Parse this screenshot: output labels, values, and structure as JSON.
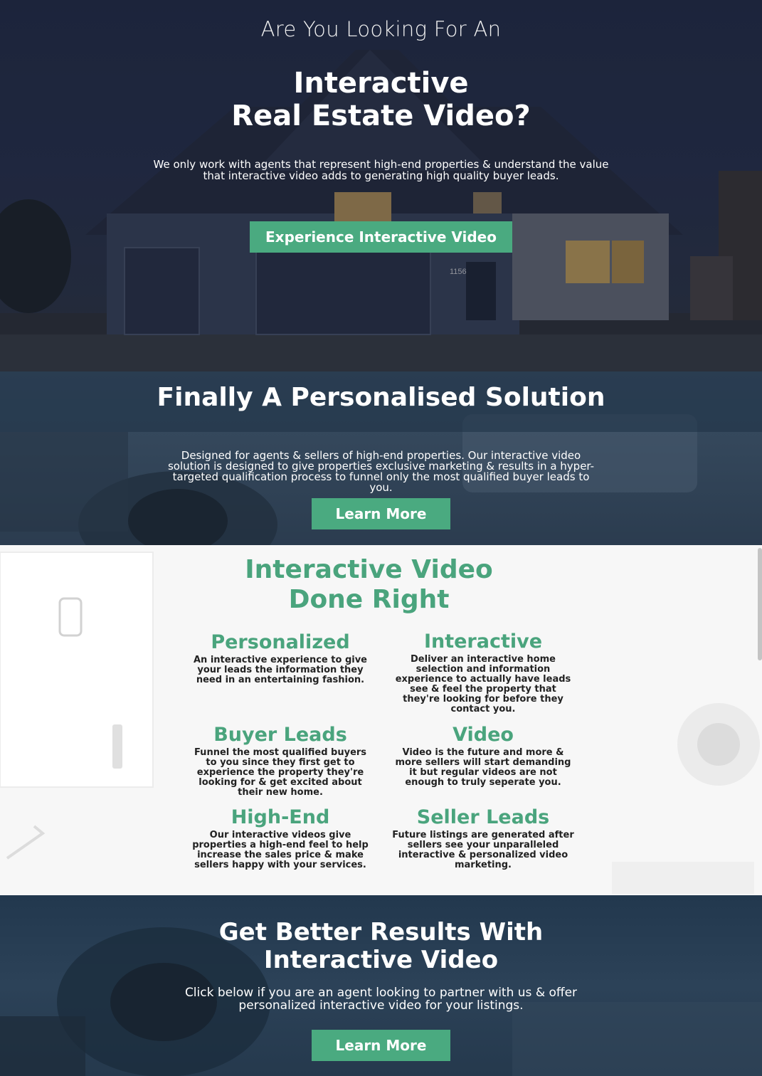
{
  "hero": {
    "eyebrow": "Are You Looking For An",
    "title_line1": "Interactive",
    "title_line2": "Real Estate Video?",
    "subtitle": "We only work with agents that represent high-end properties & understand the value that interactive video adds to generating high quality buyer leads.",
    "cta_label": "Experience Interactive Video",
    "house_number": "1156"
  },
  "solution": {
    "title": "Finally A Personalised Solution",
    "text": "Designed for agents & sellers of high-end properties. Our interactive video solution is designed to give properties exclusive marketing & results in a hyper-targeted qualification process to funnel only the most qualified buyer leads to you.",
    "cta_label": "Learn More"
  },
  "features": {
    "title_line1": "Interactive Video",
    "title_line2": "Done Right",
    "items": [
      {
        "title": "Personalized",
        "text": "An interactive experience to give your leads the information they need in an entertaining fashion."
      },
      {
        "title": "Interactive",
        "text": "Deliver an interactive home selection and information experience to actually have leads see & feel the property that they're looking for before they contact you."
      },
      {
        "title": "Buyer Leads",
        "text": "Funnel the most qualified buyers to you since they first get to experience the property they're looking for & get excited about their new home."
      },
      {
        "title": "Video",
        "text": "Video is the future and more & more sellers will start demanding it but regular videos are not enough to truly seperate you."
      },
      {
        "title": "High-End",
        "text": "Our interactive videos give properties a high-end feel to help increase the sales price & make sellers happy with your services."
      },
      {
        "title": "Seller Leads",
        "text": "Future listings are generated after sellers see your unparalleled interactive & personalized video marketing."
      }
    ]
  },
  "results": {
    "title_line1": "Get Better Results With",
    "title_line2": "Interactive Video",
    "text": "Click below if you are an agent looking to partner with us & offer personalized interactive video for your listings.",
    "cta_label": "Learn More"
  },
  "colors": {
    "accent": "#4aaa80",
    "heading_green": "#4aa47d"
  }
}
